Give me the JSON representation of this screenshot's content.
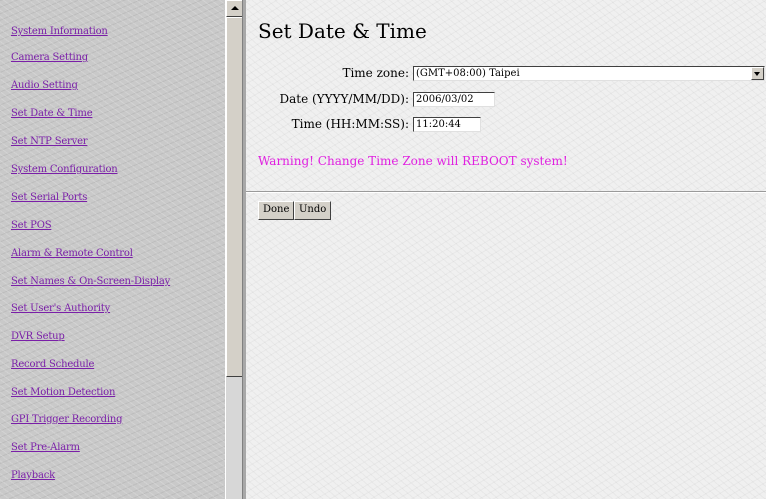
{
  "nav": {
    "items": [
      "System Information",
      "Camera Setting",
      "Audio Setting",
      "Set Date & Time",
      "Set NTP Server",
      "System Configuration",
      "Set Serial Ports",
      "Set POS",
      "Alarm & Remote Control",
      "Set Names & On-Screen-Display",
      "Set User's Authority",
      "DVR Setup",
      "Record Schedule",
      "Set Motion Detection",
      "GPI Trigger Recording",
      "Set Pre-Alarm",
      "Playback"
    ],
    "link_color": "#7a1fa8"
  },
  "page": {
    "title": "Set Date & Time",
    "timezone_label": "Time zone:",
    "timezone_value": "(GMT+08:00) Taipei",
    "date_label": "Date (YYYY/MM/DD):",
    "date_value": "2006/03/02",
    "time_label": "Time (HH:MM:SS):",
    "time_value": "11:20:44",
    "warning": "Warning! Change Time Zone will REBOOT system!",
    "warning_color": "#e020e0"
  },
  "buttons": {
    "done": "Done",
    "undo": "Undo"
  },
  "icons": {
    "scroll_up": "scroll-up-arrow-icon",
    "dropdown": "chevron-down-icon"
  }
}
